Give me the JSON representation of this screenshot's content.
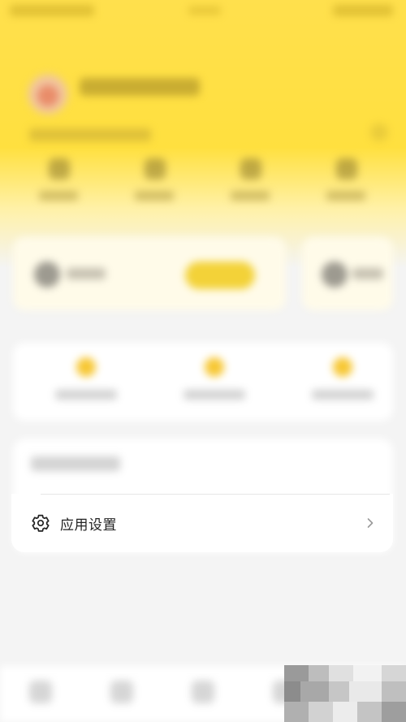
{
  "settings": {
    "label": "应用设置",
    "icon": "gear-icon",
    "chevron_icon": "chevron-right-icon"
  },
  "colors": {
    "header_yellow": "#ffe04d",
    "accent_yellow": "#f3d238",
    "background": "#f4f4f4",
    "card": "#ffffff"
  }
}
